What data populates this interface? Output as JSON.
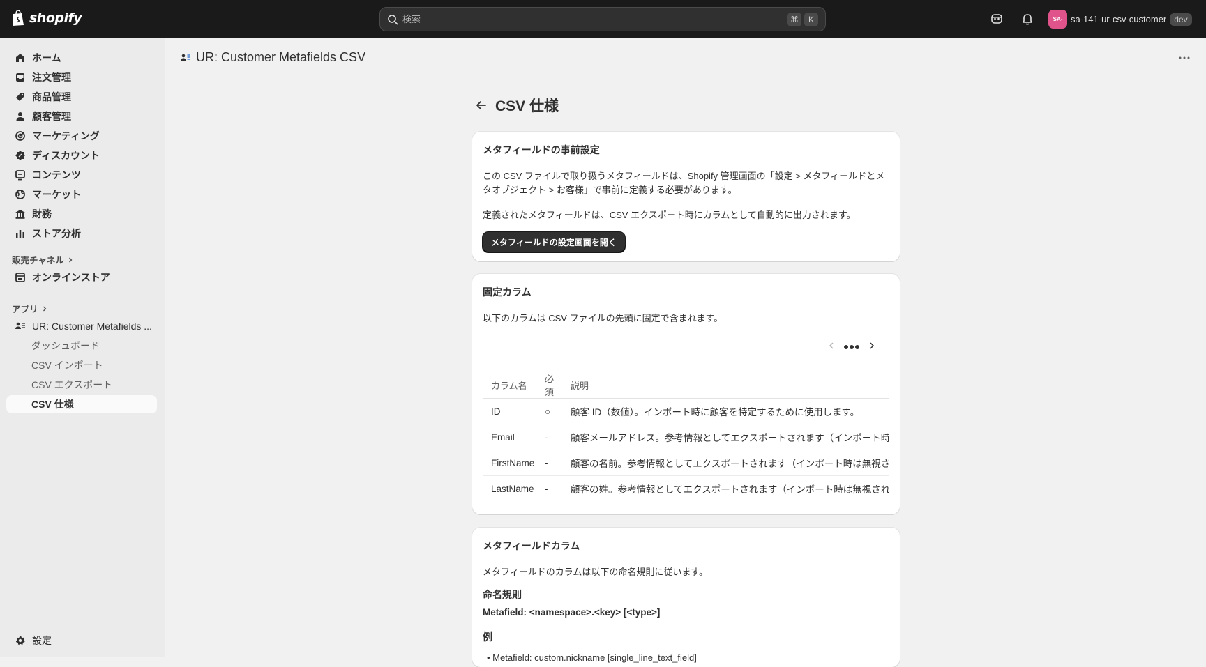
{
  "topbar": {
    "logo_text": "shopify",
    "search_placeholder": "検索",
    "shortcut_keys": [
      "⌘",
      "K"
    ],
    "account_initials": "SA-",
    "account_name": "sa-141-ur-csv-customer",
    "account_badge": "dev",
    "icons": [
      "shopify-bag-icon",
      "search-icon",
      "assistant-icon",
      "bell-icon"
    ]
  },
  "sidebar": {
    "items": [
      {
        "label": "ホーム",
        "icon": "home-icon"
      },
      {
        "label": "注文管理",
        "icon": "inbox-icon"
      },
      {
        "label": "商品管理",
        "icon": "tag-icon"
      },
      {
        "label": "顧客管理",
        "icon": "person-icon"
      },
      {
        "label": "マーケティング",
        "icon": "target-icon"
      },
      {
        "label": "ディスカウント",
        "icon": "discount-icon"
      },
      {
        "label": "コンテンツ",
        "icon": "content-icon"
      },
      {
        "label": "マーケット",
        "icon": "globe-icon"
      },
      {
        "label": "財務",
        "icon": "bank-icon"
      },
      {
        "label": "ストア分析",
        "icon": "chart-icon"
      }
    ],
    "sales_channels_label": "販売チャネル",
    "online_store_label": "オンラインストア",
    "apps_label": "アプリ",
    "app_name": "UR: Customer Metafields ...",
    "app_sub_items": [
      {
        "label": "ダッシュボード",
        "active": false
      },
      {
        "label": "CSV インポート",
        "active": false
      },
      {
        "label": "CSV エクスポート",
        "active": false
      },
      {
        "label": "CSV 仕様",
        "active": true
      }
    ],
    "settings_label": "設定"
  },
  "app_header": {
    "title": "UR: Customer Metafields CSV"
  },
  "page": {
    "title": "CSV 仕様",
    "card_prereq": {
      "heading": "メタフィールドの事前設定",
      "paragraph1": "この CSV ファイルで取り扱うメタフィールドは、Shopify 管理画面の「設定 > メタフィールドとメタオブジェクト > お客様」で事前に定義する必要があります。",
      "paragraph2": "定義されたメタフィールドは、CSV エクスポート時にカラムとして自動的に出力されます。",
      "button": "メタフィールドの設定画面を開く"
    },
    "card_fixed": {
      "heading": "固定カラム",
      "description": "以下のカラムは CSV ファイルの先頭に固定で含まれます。",
      "table": {
        "headers": [
          "カラム名",
          "必須",
          "説明"
        ],
        "rows": [
          [
            "ID",
            "○",
            "顧客 ID（数値）。インポート時に顧客を特定するために使用します。"
          ],
          [
            "Email",
            "-",
            "顧客メールアドレス。参考情報としてエクスポートされます（インポート時は無視されます）"
          ],
          [
            "FirstName",
            "-",
            "顧客の名前。参考情報としてエクスポートされます（インポート時は無視されます）"
          ],
          [
            "LastName",
            "-",
            "顧客の姓。参考情報としてエクスポートされます（インポート時は無視されます）"
          ]
        ]
      }
    },
    "card_meta": {
      "heading": "メタフィールドカラム",
      "description": "メタフィールドのカラムは以下の命名規則に従います。",
      "naming_label": "命名規則",
      "naming_pattern": "Metafield: <namespace>.<key> [<type>]",
      "example_label": "例",
      "example_first": "Metafield: custom.nickname [single_line_text_field]"
    }
  }
}
